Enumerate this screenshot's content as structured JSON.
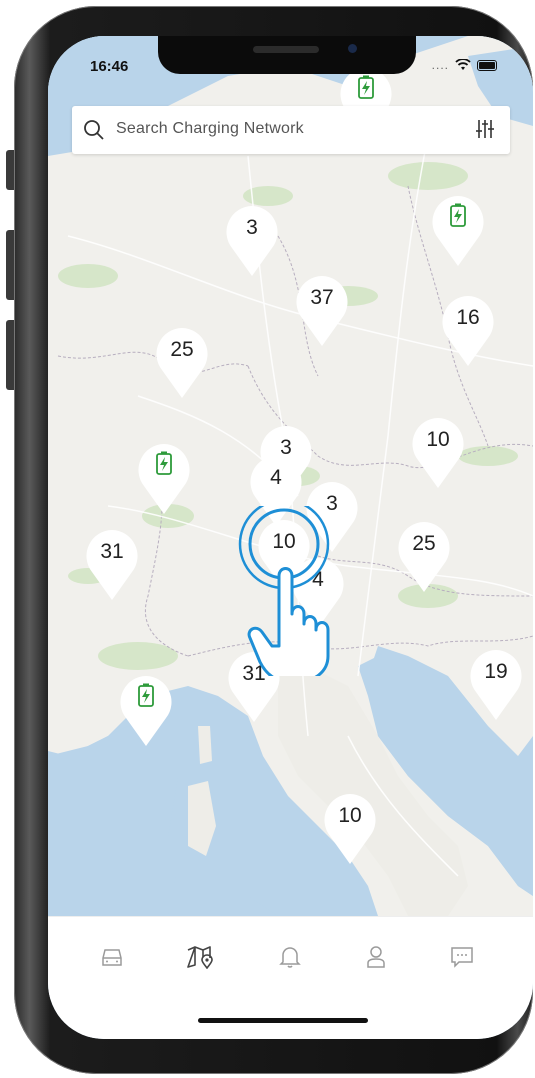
{
  "status_bar": {
    "time": "16:46",
    "signal_text": "...."
  },
  "search": {
    "placeholder": "Search Charging Network"
  },
  "map": {
    "clusters": [
      {
        "label": "3"
      },
      {
        "label": "37"
      },
      {
        "label": "16"
      },
      {
        "label": "25"
      },
      {
        "label": "10"
      },
      {
        "label": "3"
      },
      {
        "label": "4"
      },
      {
        "label": "3"
      },
      {
        "label": "31"
      },
      {
        "label": "10"
      },
      {
        "label": "25"
      },
      {
        "label": "4"
      },
      {
        "label": "31"
      },
      {
        "label": "19"
      },
      {
        "label": "10"
      }
    ],
    "charger_pins": 4,
    "station_icon_name": "charging-station-icon"
  },
  "tab_bar": {
    "items": [
      {
        "name": "car-icon"
      },
      {
        "name": "map-icon"
      },
      {
        "name": "bell-icon"
      },
      {
        "name": "user-icon"
      },
      {
        "name": "chat-icon"
      }
    ],
    "active_color": "#444444",
    "inactive_color": "#9a9a9a"
  },
  "colors": {
    "pin_green": "#2e9b3b",
    "tap_ring": "#1e8fd6",
    "water": "#b9d4ea",
    "land": "#f1f0ec"
  }
}
